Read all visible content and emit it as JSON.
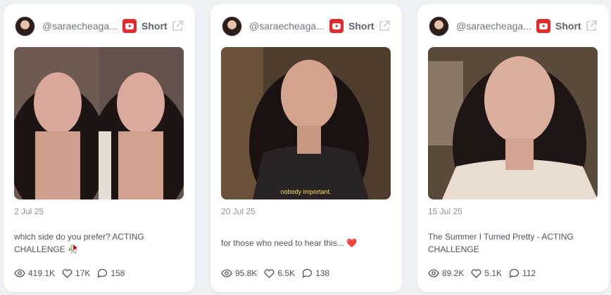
{
  "cards": [
    {
      "handle": "@saraecheaga...",
      "platform": "Short",
      "date": "2 Jul 25",
      "caption": "which side do you prefer? ACTING CHALLENGE 🥀",
      "views": "419.1K",
      "likes": "17K",
      "comments": "158"
    },
    {
      "handle": "@saraecheaga...",
      "platform": "Short",
      "date": "20 Jul 25",
      "caption": "for those who need to hear this... ❤️",
      "subtitle": "nobody important.",
      "views": "95.8K",
      "likes": "6.5K",
      "comments": "138"
    },
    {
      "handle": "@saraecheaga...",
      "platform": "Short",
      "date": "15 Jul 25",
      "caption": "The Summer I Turned Pretty - ACTING CHALLENGE",
      "views": "89.2K",
      "likes": "5.1K",
      "comments": "112"
    }
  ],
  "icons": {
    "platform": "youtube-icon",
    "external": "external-link-icon",
    "views": "eye-icon",
    "likes": "heart-icon",
    "comments": "comment-icon"
  },
  "colors": {
    "youtube": "#e32b2b",
    "subtitle": "#f6e04a"
  }
}
